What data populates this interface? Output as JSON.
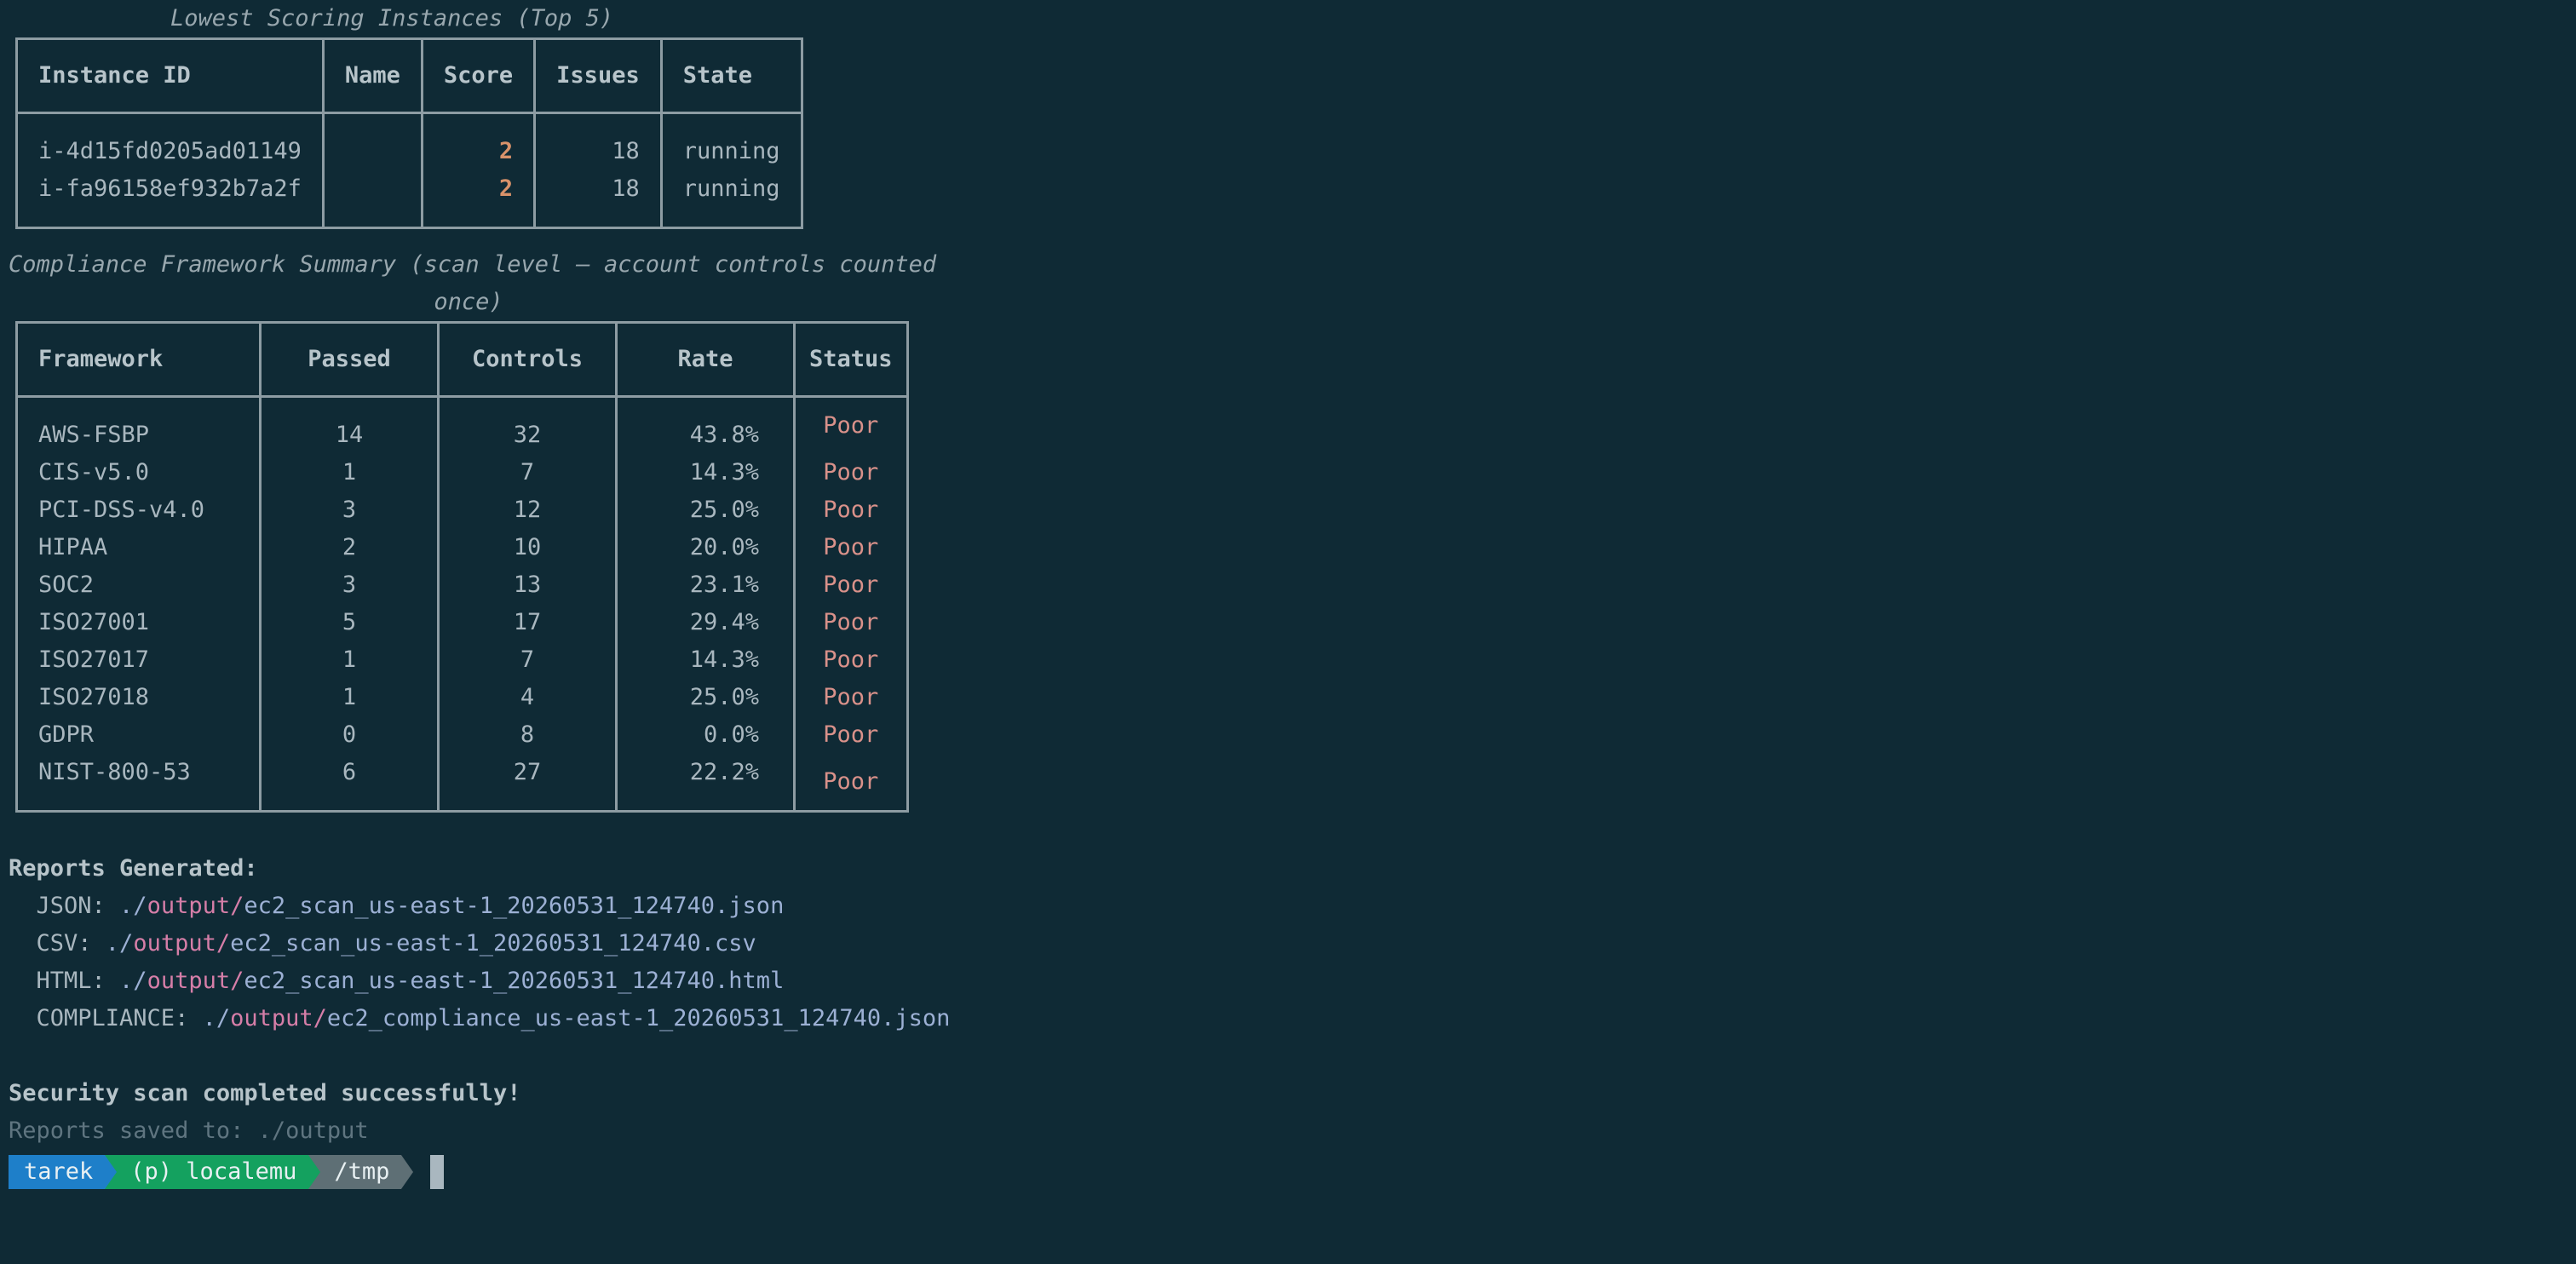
{
  "lowest_scoring": {
    "title": "Lowest Scoring Instances (Top 5)",
    "headers": [
      "Instance ID",
      "Name",
      "Score",
      "Issues",
      "State"
    ],
    "rows": [
      {
        "id": "i-4d15fd0205ad01149",
        "name": "",
        "score": "2",
        "issues": "18",
        "state": "running"
      },
      {
        "id": "i-fa96158ef932b7a2f",
        "name": "",
        "score": "2",
        "issues": "18",
        "state": "running"
      }
    ]
  },
  "compliance": {
    "title_line1": "Compliance Framework Summary (scan level — account controls counted",
    "title_line2": "once)",
    "headers": [
      "Framework",
      "Passed",
      "Controls",
      "Rate",
      "Status"
    ],
    "rows": [
      {
        "framework": "AWS-FSBP",
        "passed": "14",
        "controls": "32",
        "rate": "43.8%",
        "status": "Poor"
      },
      {
        "framework": "CIS-v5.0",
        "passed": "1",
        "controls": "7",
        "rate": "14.3%",
        "status": "Poor"
      },
      {
        "framework": "PCI-DSS-v4.0",
        "passed": "3",
        "controls": "12",
        "rate": "25.0%",
        "status": "Poor"
      },
      {
        "framework": "HIPAA",
        "passed": "2",
        "controls": "10",
        "rate": "20.0%",
        "status": "Poor"
      },
      {
        "framework": "SOC2",
        "passed": "3",
        "controls": "13",
        "rate": "23.1%",
        "status": "Poor"
      },
      {
        "framework": "ISO27001",
        "passed": "5",
        "controls": "17",
        "rate": "29.4%",
        "status": "Poor"
      },
      {
        "framework": "ISO27017",
        "passed": "1",
        "controls": "7",
        "rate": "14.3%",
        "status": "Poor"
      },
      {
        "framework": "ISO27018",
        "passed": "1",
        "controls": "4",
        "rate": "25.0%",
        "status": "Poor"
      },
      {
        "framework": "GDPR",
        "passed": "0",
        "controls": "8",
        "rate": "0.0%",
        "status": "Poor"
      },
      {
        "framework": "NIST-800-53",
        "passed": "6",
        "controls": "27",
        "rate": "22.2%",
        "status": "Poor"
      }
    ]
  },
  "reports": {
    "heading": "Reports Generated:",
    "items": [
      {
        "label": "  JSON: ",
        "prefix": "./",
        "dir": "output/",
        "file": "ec2_scan_us-east-1_20260531_124740.json"
      },
      {
        "label": "  CSV: ",
        "prefix": "./",
        "dir": "output/",
        "file": "ec2_scan_us-east-1_20260531_124740.csv"
      },
      {
        "label": "  HTML: ",
        "prefix": "./",
        "dir": "output/",
        "file": "ec2_scan_us-east-1_20260531_124740.html"
      },
      {
        "label": "  COMPLIANCE: ",
        "prefix": "./",
        "dir": "output/",
        "file": "ec2_compliance_us-east-1_20260531_124740.json"
      }
    ]
  },
  "footer": {
    "success": "Security scan completed successfully!",
    "saved": "Reports saved to: ./output"
  },
  "prompt": {
    "user": "tarek",
    "env": "(p) localemu",
    "dir": "/tmp"
  },
  "colors": {
    "background": "#0f2a35",
    "user_segment": "#1e7fc9",
    "env_segment": "#14a15f",
    "dir_segment": "#5e6f75",
    "poor_status": "#d9918a",
    "score": "#d8926a",
    "path_dir": "#d67ea8"
  }
}
